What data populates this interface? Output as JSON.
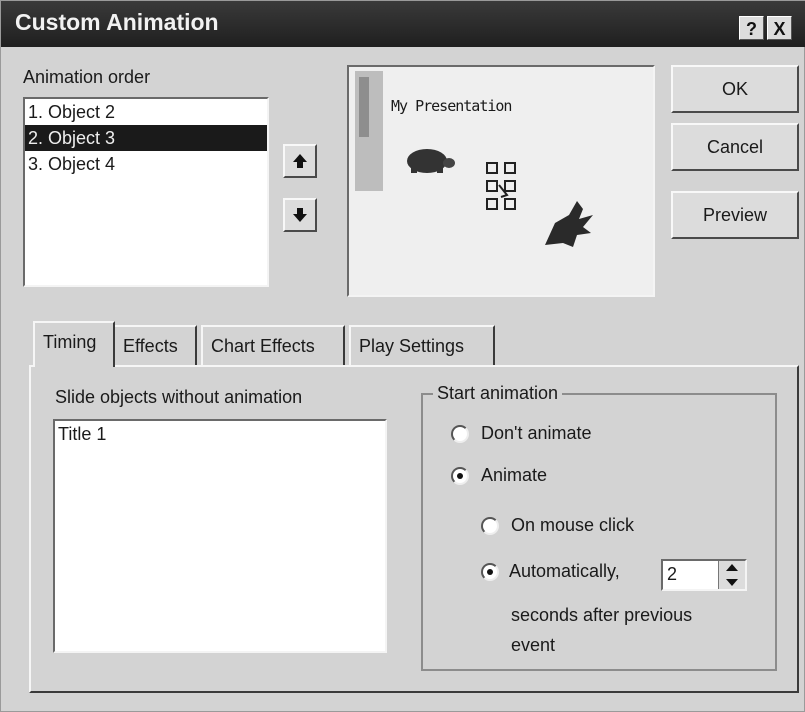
{
  "window": {
    "title": "Custom Animation",
    "help_label": "?",
    "close_label": "X"
  },
  "animation_order": {
    "label": "Animation order",
    "items": [
      "1. Object 2",
      "2. Object 3",
      "3. Object 4"
    ],
    "selected_index": 1
  },
  "preview": {
    "slide_title": "My Presentation"
  },
  "buttons": {
    "ok": "OK",
    "cancel": "Cancel",
    "preview": "Preview"
  },
  "tabs": [
    "Timing",
    "Effects",
    "Chart Effects",
    "Play Settings"
  ],
  "active_tab": "Timing",
  "timing": {
    "objects_label": "Slide objects without animation",
    "objects": [
      "Title 1"
    ],
    "start_group_label": "Start animation",
    "dont_animate": "Don't animate",
    "animate": "Animate",
    "on_mouse_click": "On mouse click",
    "automatically": "Automatically,",
    "seconds_value": "2",
    "seconds_label_1": "seconds after previous",
    "seconds_label_2": "event",
    "selected_start": "animate",
    "selected_trigger": "automatically"
  },
  "icons": {
    "move_up": "up-arrow-icon",
    "move_down": "down-arrow-icon"
  }
}
